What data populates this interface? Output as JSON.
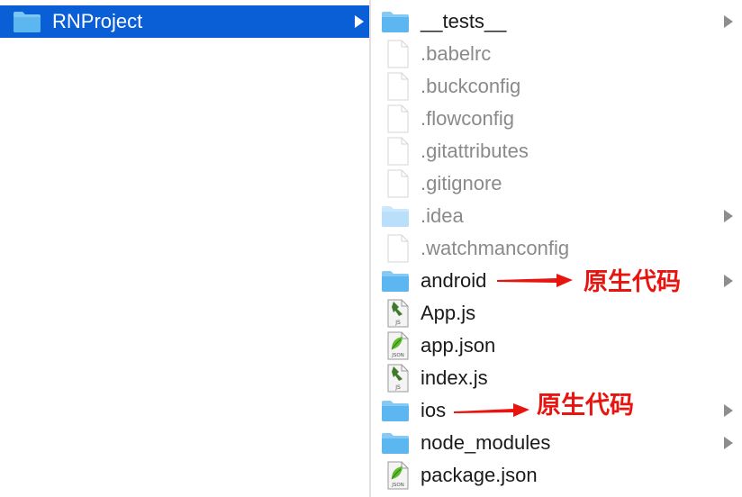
{
  "left_column": {
    "items": [
      {
        "label": "RNProject",
        "kind": "folder",
        "selected": true,
        "has_children": true
      }
    ]
  },
  "right_column": {
    "items": [
      {
        "label": "__tests__",
        "kind": "folder",
        "dim": false,
        "has_children": true
      },
      {
        "label": ".babelrc",
        "kind": "file",
        "dim": true,
        "has_children": false
      },
      {
        "label": ".buckconfig",
        "kind": "file",
        "dim": true,
        "has_children": false
      },
      {
        "label": ".flowconfig",
        "kind": "file",
        "dim": true,
        "has_children": false
      },
      {
        "label": ".gitattributes",
        "kind": "file",
        "dim": true,
        "has_children": false
      },
      {
        "label": ".gitignore",
        "kind": "file",
        "dim": true,
        "has_children": false
      },
      {
        "label": ".idea",
        "kind": "folder-light",
        "dim": true,
        "has_children": true
      },
      {
        "label": ".watchmanconfig",
        "kind": "file",
        "dim": true,
        "has_children": false
      },
      {
        "label": "android",
        "kind": "folder",
        "dim": false,
        "has_children": true
      },
      {
        "label": "App.js",
        "kind": "js",
        "dim": false,
        "has_children": false
      },
      {
        "label": "app.json",
        "kind": "json",
        "dim": false,
        "has_children": false
      },
      {
        "label": "index.js",
        "kind": "js",
        "dim": false,
        "has_children": false
      },
      {
        "label": "ios",
        "kind": "folder",
        "dim": false,
        "has_children": true
      },
      {
        "label": "node_modules",
        "kind": "folder",
        "dim": false,
        "has_children": true
      },
      {
        "label": "package.json",
        "kind": "json",
        "dim": false,
        "has_children": false
      }
    ]
  },
  "annotations": [
    {
      "target": "android",
      "text": "原生代码"
    },
    {
      "target": "ios",
      "text": "原生代码"
    }
  ],
  "icon_labels": {
    "js": "JS",
    "json": "JSON"
  },
  "colors": {
    "selection": "#0a5fd7",
    "folder": "#5cb7f0",
    "folder_light": "#b9dffa",
    "annotation": "#e8140f"
  }
}
